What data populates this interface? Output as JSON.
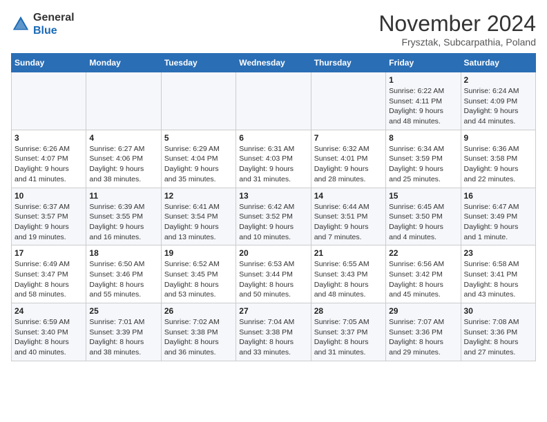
{
  "header": {
    "logo_line1": "General",
    "logo_line2": "Blue",
    "month": "November 2024",
    "location": "Frysztak, Subcarpathia, Poland"
  },
  "weekdays": [
    "Sunday",
    "Monday",
    "Tuesday",
    "Wednesday",
    "Thursday",
    "Friday",
    "Saturday"
  ],
  "weeks": [
    [
      {
        "day": "",
        "info": ""
      },
      {
        "day": "",
        "info": ""
      },
      {
        "day": "",
        "info": ""
      },
      {
        "day": "",
        "info": ""
      },
      {
        "day": "",
        "info": ""
      },
      {
        "day": "1",
        "info": "Sunrise: 6:22 AM\nSunset: 4:11 PM\nDaylight: 9 hours\nand 48 minutes."
      },
      {
        "day": "2",
        "info": "Sunrise: 6:24 AM\nSunset: 4:09 PM\nDaylight: 9 hours\nand 44 minutes."
      }
    ],
    [
      {
        "day": "3",
        "info": "Sunrise: 6:26 AM\nSunset: 4:07 PM\nDaylight: 9 hours\nand 41 minutes."
      },
      {
        "day": "4",
        "info": "Sunrise: 6:27 AM\nSunset: 4:06 PM\nDaylight: 9 hours\nand 38 minutes."
      },
      {
        "day": "5",
        "info": "Sunrise: 6:29 AM\nSunset: 4:04 PM\nDaylight: 9 hours\nand 35 minutes."
      },
      {
        "day": "6",
        "info": "Sunrise: 6:31 AM\nSunset: 4:03 PM\nDaylight: 9 hours\nand 31 minutes."
      },
      {
        "day": "7",
        "info": "Sunrise: 6:32 AM\nSunset: 4:01 PM\nDaylight: 9 hours\nand 28 minutes."
      },
      {
        "day": "8",
        "info": "Sunrise: 6:34 AM\nSunset: 3:59 PM\nDaylight: 9 hours\nand 25 minutes."
      },
      {
        "day": "9",
        "info": "Sunrise: 6:36 AM\nSunset: 3:58 PM\nDaylight: 9 hours\nand 22 minutes."
      }
    ],
    [
      {
        "day": "10",
        "info": "Sunrise: 6:37 AM\nSunset: 3:57 PM\nDaylight: 9 hours\nand 19 minutes."
      },
      {
        "day": "11",
        "info": "Sunrise: 6:39 AM\nSunset: 3:55 PM\nDaylight: 9 hours\nand 16 minutes."
      },
      {
        "day": "12",
        "info": "Sunrise: 6:41 AM\nSunset: 3:54 PM\nDaylight: 9 hours\nand 13 minutes."
      },
      {
        "day": "13",
        "info": "Sunrise: 6:42 AM\nSunset: 3:52 PM\nDaylight: 9 hours\nand 10 minutes."
      },
      {
        "day": "14",
        "info": "Sunrise: 6:44 AM\nSunset: 3:51 PM\nDaylight: 9 hours\nand 7 minutes."
      },
      {
        "day": "15",
        "info": "Sunrise: 6:45 AM\nSunset: 3:50 PM\nDaylight: 9 hours\nand 4 minutes."
      },
      {
        "day": "16",
        "info": "Sunrise: 6:47 AM\nSunset: 3:49 PM\nDaylight: 9 hours\nand 1 minute."
      }
    ],
    [
      {
        "day": "17",
        "info": "Sunrise: 6:49 AM\nSunset: 3:47 PM\nDaylight: 8 hours\nand 58 minutes."
      },
      {
        "day": "18",
        "info": "Sunrise: 6:50 AM\nSunset: 3:46 PM\nDaylight: 8 hours\nand 55 minutes."
      },
      {
        "day": "19",
        "info": "Sunrise: 6:52 AM\nSunset: 3:45 PM\nDaylight: 8 hours\nand 53 minutes."
      },
      {
        "day": "20",
        "info": "Sunrise: 6:53 AM\nSunset: 3:44 PM\nDaylight: 8 hours\nand 50 minutes."
      },
      {
        "day": "21",
        "info": "Sunrise: 6:55 AM\nSunset: 3:43 PM\nDaylight: 8 hours\nand 48 minutes."
      },
      {
        "day": "22",
        "info": "Sunrise: 6:56 AM\nSunset: 3:42 PM\nDaylight: 8 hours\nand 45 minutes."
      },
      {
        "day": "23",
        "info": "Sunrise: 6:58 AM\nSunset: 3:41 PM\nDaylight: 8 hours\nand 43 minutes."
      }
    ],
    [
      {
        "day": "24",
        "info": "Sunrise: 6:59 AM\nSunset: 3:40 PM\nDaylight: 8 hours\nand 40 minutes."
      },
      {
        "day": "25",
        "info": "Sunrise: 7:01 AM\nSunset: 3:39 PM\nDaylight: 8 hours\nand 38 minutes."
      },
      {
        "day": "26",
        "info": "Sunrise: 7:02 AM\nSunset: 3:38 PM\nDaylight: 8 hours\nand 36 minutes."
      },
      {
        "day": "27",
        "info": "Sunrise: 7:04 AM\nSunset: 3:38 PM\nDaylight: 8 hours\nand 33 minutes."
      },
      {
        "day": "28",
        "info": "Sunrise: 7:05 AM\nSunset: 3:37 PM\nDaylight: 8 hours\nand 31 minutes."
      },
      {
        "day": "29",
        "info": "Sunrise: 7:07 AM\nSunset: 3:36 PM\nDaylight: 8 hours\nand 29 minutes."
      },
      {
        "day": "30",
        "info": "Sunrise: 7:08 AM\nSunset: 3:36 PM\nDaylight: 8 hours\nand 27 minutes."
      }
    ]
  ]
}
